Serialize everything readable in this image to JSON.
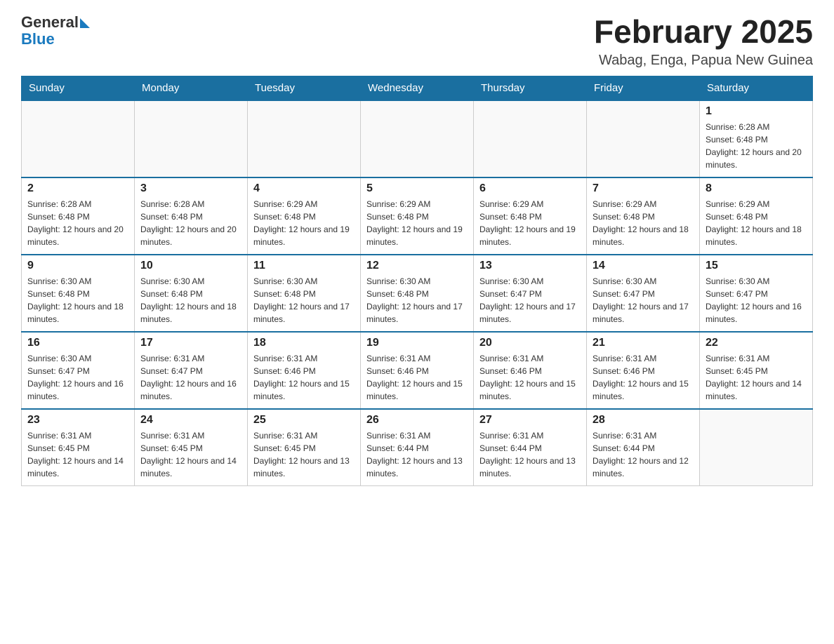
{
  "header": {
    "logo_text_general": "General",
    "logo_text_blue": "Blue",
    "month_title": "February 2025",
    "location": "Wabag, Enga, Papua New Guinea"
  },
  "weekdays": [
    "Sunday",
    "Monday",
    "Tuesday",
    "Wednesday",
    "Thursday",
    "Friday",
    "Saturday"
  ],
  "weeks": [
    [
      {
        "day": "",
        "sunrise": "",
        "sunset": "",
        "daylight": ""
      },
      {
        "day": "",
        "sunrise": "",
        "sunset": "",
        "daylight": ""
      },
      {
        "day": "",
        "sunrise": "",
        "sunset": "",
        "daylight": ""
      },
      {
        "day": "",
        "sunrise": "",
        "sunset": "",
        "daylight": ""
      },
      {
        "day": "",
        "sunrise": "",
        "sunset": "",
        "daylight": ""
      },
      {
        "day": "",
        "sunrise": "",
        "sunset": "",
        "daylight": ""
      },
      {
        "day": "1",
        "sunrise": "Sunrise: 6:28 AM",
        "sunset": "Sunset: 6:48 PM",
        "daylight": "Daylight: 12 hours and 20 minutes."
      }
    ],
    [
      {
        "day": "2",
        "sunrise": "Sunrise: 6:28 AM",
        "sunset": "Sunset: 6:48 PM",
        "daylight": "Daylight: 12 hours and 20 minutes."
      },
      {
        "day": "3",
        "sunrise": "Sunrise: 6:28 AM",
        "sunset": "Sunset: 6:48 PM",
        "daylight": "Daylight: 12 hours and 20 minutes."
      },
      {
        "day": "4",
        "sunrise": "Sunrise: 6:29 AM",
        "sunset": "Sunset: 6:48 PM",
        "daylight": "Daylight: 12 hours and 19 minutes."
      },
      {
        "day": "5",
        "sunrise": "Sunrise: 6:29 AM",
        "sunset": "Sunset: 6:48 PM",
        "daylight": "Daylight: 12 hours and 19 minutes."
      },
      {
        "day": "6",
        "sunrise": "Sunrise: 6:29 AM",
        "sunset": "Sunset: 6:48 PM",
        "daylight": "Daylight: 12 hours and 19 minutes."
      },
      {
        "day": "7",
        "sunrise": "Sunrise: 6:29 AM",
        "sunset": "Sunset: 6:48 PM",
        "daylight": "Daylight: 12 hours and 18 minutes."
      },
      {
        "day": "8",
        "sunrise": "Sunrise: 6:29 AM",
        "sunset": "Sunset: 6:48 PM",
        "daylight": "Daylight: 12 hours and 18 minutes."
      }
    ],
    [
      {
        "day": "9",
        "sunrise": "Sunrise: 6:30 AM",
        "sunset": "Sunset: 6:48 PM",
        "daylight": "Daylight: 12 hours and 18 minutes."
      },
      {
        "day": "10",
        "sunrise": "Sunrise: 6:30 AM",
        "sunset": "Sunset: 6:48 PM",
        "daylight": "Daylight: 12 hours and 18 minutes."
      },
      {
        "day": "11",
        "sunrise": "Sunrise: 6:30 AM",
        "sunset": "Sunset: 6:48 PM",
        "daylight": "Daylight: 12 hours and 17 minutes."
      },
      {
        "day": "12",
        "sunrise": "Sunrise: 6:30 AM",
        "sunset": "Sunset: 6:48 PM",
        "daylight": "Daylight: 12 hours and 17 minutes."
      },
      {
        "day": "13",
        "sunrise": "Sunrise: 6:30 AM",
        "sunset": "Sunset: 6:47 PM",
        "daylight": "Daylight: 12 hours and 17 minutes."
      },
      {
        "day": "14",
        "sunrise": "Sunrise: 6:30 AM",
        "sunset": "Sunset: 6:47 PM",
        "daylight": "Daylight: 12 hours and 17 minutes."
      },
      {
        "day": "15",
        "sunrise": "Sunrise: 6:30 AM",
        "sunset": "Sunset: 6:47 PM",
        "daylight": "Daylight: 12 hours and 16 minutes."
      }
    ],
    [
      {
        "day": "16",
        "sunrise": "Sunrise: 6:30 AM",
        "sunset": "Sunset: 6:47 PM",
        "daylight": "Daylight: 12 hours and 16 minutes."
      },
      {
        "day": "17",
        "sunrise": "Sunrise: 6:31 AM",
        "sunset": "Sunset: 6:47 PM",
        "daylight": "Daylight: 12 hours and 16 minutes."
      },
      {
        "day": "18",
        "sunrise": "Sunrise: 6:31 AM",
        "sunset": "Sunset: 6:46 PM",
        "daylight": "Daylight: 12 hours and 15 minutes."
      },
      {
        "day": "19",
        "sunrise": "Sunrise: 6:31 AM",
        "sunset": "Sunset: 6:46 PM",
        "daylight": "Daylight: 12 hours and 15 minutes."
      },
      {
        "day": "20",
        "sunrise": "Sunrise: 6:31 AM",
        "sunset": "Sunset: 6:46 PM",
        "daylight": "Daylight: 12 hours and 15 minutes."
      },
      {
        "day": "21",
        "sunrise": "Sunrise: 6:31 AM",
        "sunset": "Sunset: 6:46 PM",
        "daylight": "Daylight: 12 hours and 15 minutes."
      },
      {
        "day": "22",
        "sunrise": "Sunrise: 6:31 AM",
        "sunset": "Sunset: 6:45 PM",
        "daylight": "Daylight: 12 hours and 14 minutes."
      }
    ],
    [
      {
        "day": "23",
        "sunrise": "Sunrise: 6:31 AM",
        "sunset": "Sunset: 6:45 PM",
        "daylight": "Daylight: 12 hours and 14 minutes."
      },
      {
        "day": "24",
        "sunrise": "Sunrise: 6:31 AM",
        "sunset": "Sunset: 6:45 PM",
        "daylight": "Daylight: 12 hours and 14 minutes."
      },
      {
        "day": "25",
        "sunrise": "Sunrise: 6:31 AM",
        "sunset": "Sunset: 6:45 PM",
        "daylight": "Daylight: 12 hours and 13 minutes."
      },
      {
        "day": "26",
        "sunrise": "Sunrise: 6:31 AM",
        "sunset": "Sunset: 6:44 PM",
        "daylight": "Daylight: 12 hours and 13 minutes."
      },
      {
        "day": "27",
        "sunrise": "Sunrise: 6:31 AM",
        "sunset": "Sunset: 6:44 PM",
        "daylight": "Daylight: 12 hours and 13 minutes."
      },
      {
        "day": "28",
        "sunrise": "Sunrise: 6:31 AM",
        "sunset": "Sunset: 6:44 PM",
        "daylight": "Daylight: 12 hours and 12 minutes."
      },
      {
        "day": "",
        "sunrise": "",
        "sunset": "",
        "daylight": ""
      }
    ]
  ]
}
